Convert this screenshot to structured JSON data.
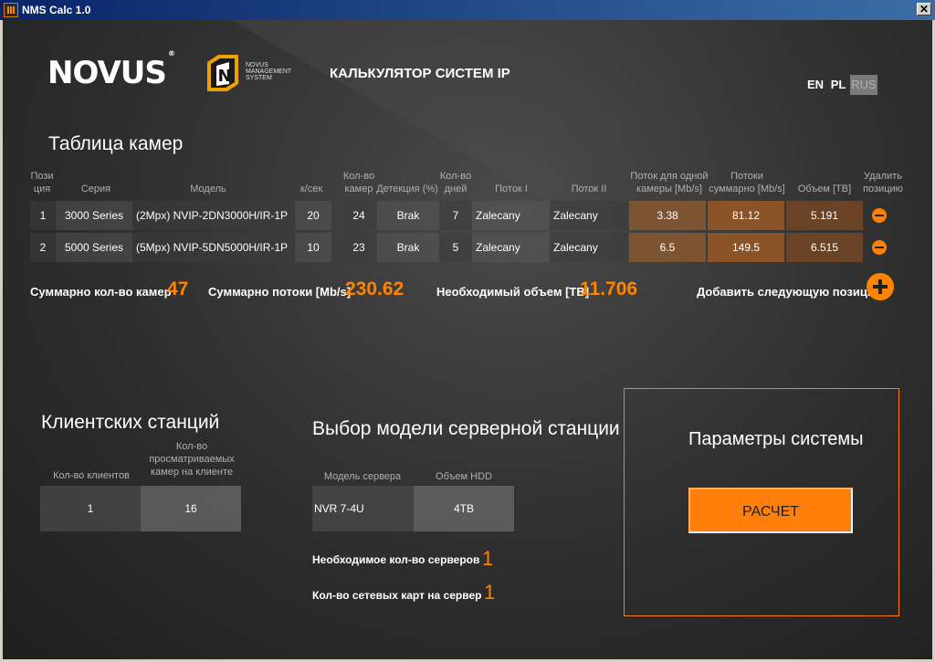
{
  "window": {
    "title": "NMS Calc 1.0",
    "close_label": "✕"
  },
  "header": {
    "logo_text": "NOVUS",
    "logo_registered": "®",
    "nms_logo_lines": [
      "NOVUS",
      "MANAGEMENT",
      "SYSTEM"
    ],
    "heading": "КАЛЬКУЛЯТОР СИСТЕМ IP",
    "languages": [
      "EN",
      "PL",
      "RUS"
    ],
    "active_language": "RUS"
  },
  "camera_table": {
    "title": "Таблица камер",
    "columns": {
      "position": [
        "Пози",
        "ция"
      ],
      "series": "Серия",
      "model": "Модель",
      "fps": "к/сек",
      "cam_count": [
        "Кол-во",
        "камер"
      ],
      "detection": "Детекция (%)",
      "days": [
        "Кол-во",
        "дней"
      ],
      "stream1": "Поток I",
      "stream2": "Поток II",
      "stream_one": [
        "Поток для одной",
        "камеры [Mb/s]"
      ],
      "stream_total": [
        "Потоки",
        "суммарно [Mb/s]"
      ],
      "volume": "Объем [TB]",
      "delete": [
        "Удалить",
        "позицию"
      ]
    },
    "rows": [
      {
        "position": "1",
        "series": "3000 Series",
        "model": "(2Mpx) NVIP-2DN3000H/IR-1P",
        "fps": "20",
        "cam_count": "24",
        "detection": "Brak",
        "days": "7",
        "stream1": "Zalecany",
        "stream2": "Zalecany",
        "stream_one": "3.38",
        "stream_total": "81.12",
        "volume": "5.191"
      },
      {
        "position": "2",
        "series": "5000 Series",
        "model": "(5Mpx) NVIP-5DN5000H/IR-1P",
        "fps": "10",
        "cam_count": "23",
        "detection": "Brak",
        "days": "5",
        "stream1": "Zalecany",
        "stream2": "Zalecany",
        "stream_one": "6.5",
        "stream_total": "149.5",
        "volume": "6.515"
      }
    ]
  },
  "summary": {
    "cameras_label": "Суммарно кол-во камер",
    "cameras_value": "47",
    "streams_label": "Суммарно потоки [Mb/s]",
    "streams_value": "230.62",
    "volume_label": "Необходимый объем [TB]",
    "volume_value": "11.706",
    "add_label": "Добавить следующую позицию"
  },
  "clients": {
    "title": "Клиентских станций",
    "col1": "Кол-во клиентов",
    "col2": [
      "Кол-во",
      "просматриваемых",
      "камер на клиенте"
    ],
    "value1": "1",
    "value2": "16"
  },
  "server": {
    "title": "Выбор модели серверной станции",
    "col1": "Модель сервера",
    "col2": "Объем HDD",
    "model": "NVR 7-4U",
    "hdd": "4TB",
    "servers_label": "Необходимое кол-во серверов",
    "servers_value": "1",
    "nics_label": "Кол-во сетевых карт на сервер",
    "nics_value": "1"
  },
  "params": {
    "title": "Параметры системы",
    "calc_label": "РАСЧЕТ"
  },
  "colors": {
    "accent": "#ff8400",
    "background": "#2e2e2e"
  }
}
